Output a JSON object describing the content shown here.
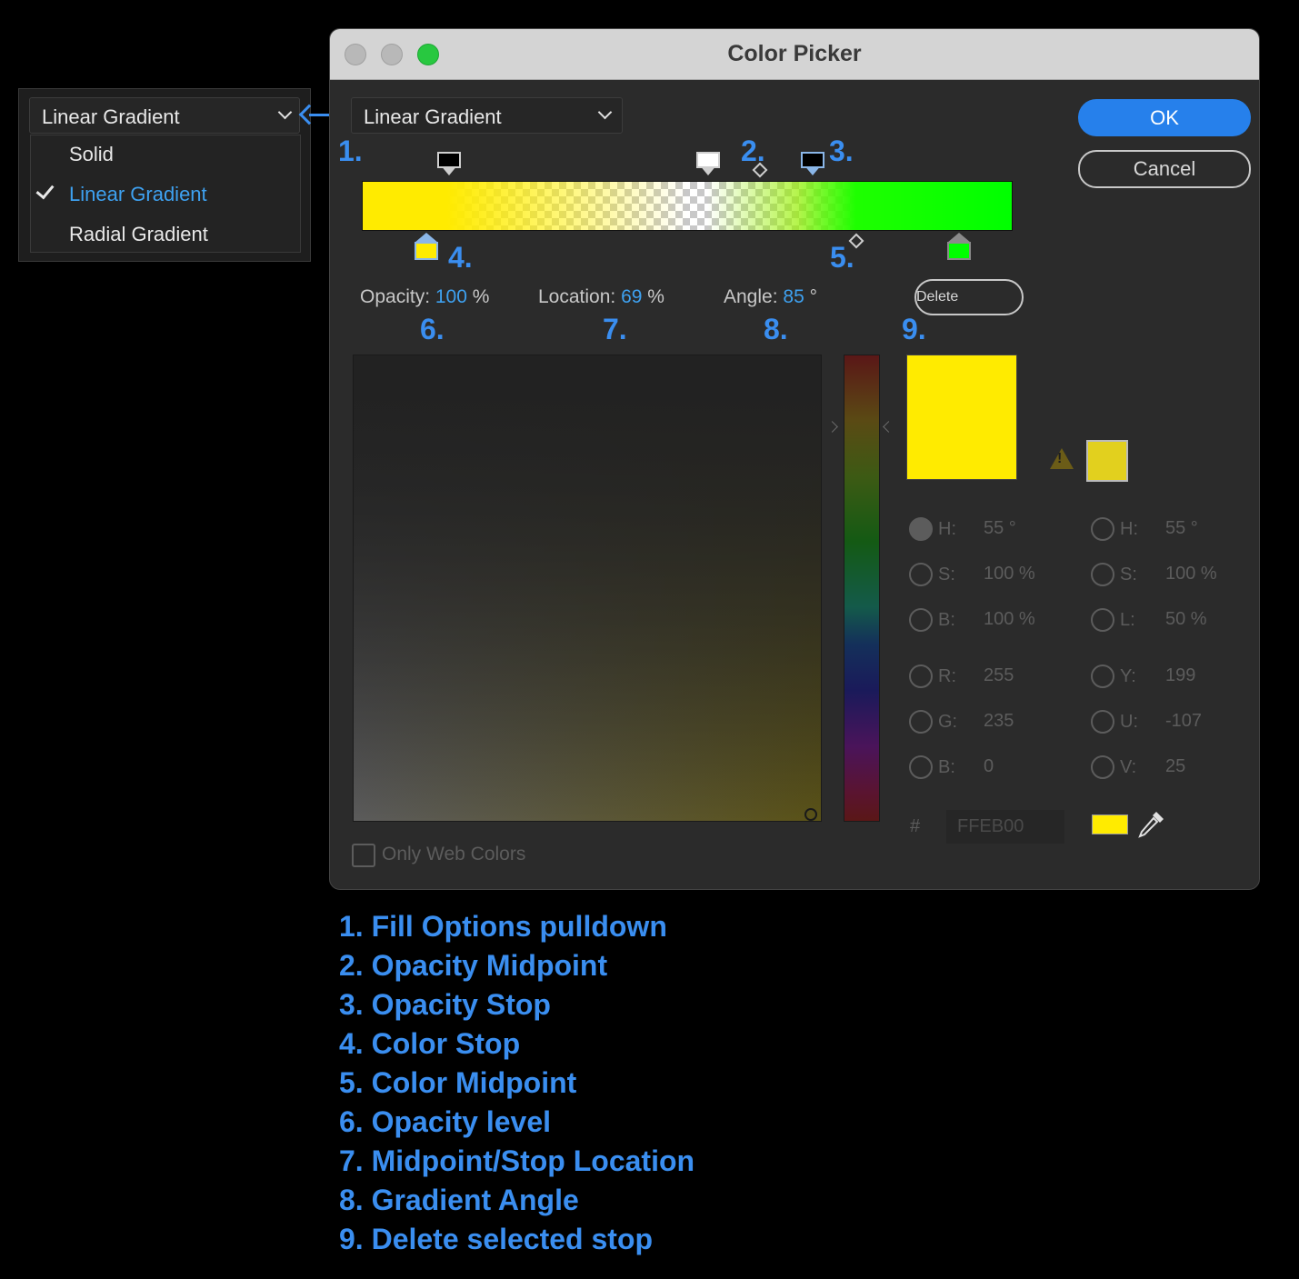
{
  "side_menu": {
    "selected": "Linear Gradient",
    "options": [
      "Solid",
      "Linear Gradient",
      "Radial Gradient"
    ]
  },
  "window": {
    "title": "Color Picker",
    "fill_option": "Linear Gradient",
    "ok_label": "OK",
    "cancel_label": "Cancel",
    "delete_label": "Delete"
  },
  "gradient": {
    "opacity_label": "Opacity:",
    "opacity_value": "100",
    "opacity_unit": "%",
    "location_label": "Location:",
    "location_value": "69",
    "location_unit": "%",
    "angle_label": "Angle:",
    "angle_value": "85",
    "angle_unit": "°"
  },
  "callouts": [
    "1.",
    "2.",
    "3.",
    "4.",
    "5.",
    "6.",
    "7.",
    "8.",
    "9."
  ],
  "hsb": {
    "h_label": "H:",
    "h_value": "55 °",
    "s_label": "S:",
    "s_value": "100 %",
    "b_label": "B:",
    "b_value": "100 %"
  },
  "hsl": {
    "h_label": "H:",
    "h_value": "55 °",
    "s_label": "S:",
    "s_value": "100 %",
    "l_label": "L:",
    "l_value": "50 %"
  },
  "rgb": {
    "r_label": "R:",
    "r_value": "255",
    "g_label": "G:",
    "g_value": "235",
    "b_label": "B:",
    "b_value": "0"
  },
  "yuv": {
    "y_label": "Y:",
    "y_value": "199",
    "u_label": "U:",
    "u_value": "-107",
    "v_label": "V:",
    "v_value": "25"
  },
  "hex": {
    "hash": "#",
    "value": "FFEB00"
  },
  "web_colors_label": "Only Web Colors",
  "colors": {
    "selected": "#ffeb00",
    "web_safe": "#e2d01e",
    "accent": "#3a8ef0",
    "ok_button": "#2680eb"
  },
  "icons": [
    "check-icon",
    "chevron-down-icon",
    "warning-icon",
    "eyedropper-icon"
  ],
  "legend": [
    "1. Fill Options pulldown",
    "2. Opacity Midpoint",
    "3. Opacity Stop",
    "4. Color Stop",
    "5. Color Midpoint",
    "6. Opacity level",
    "7. Midpoint/Stop Location",
    "8. Gradient Angle",
    "9. Delete selected stop"
  ]
}
